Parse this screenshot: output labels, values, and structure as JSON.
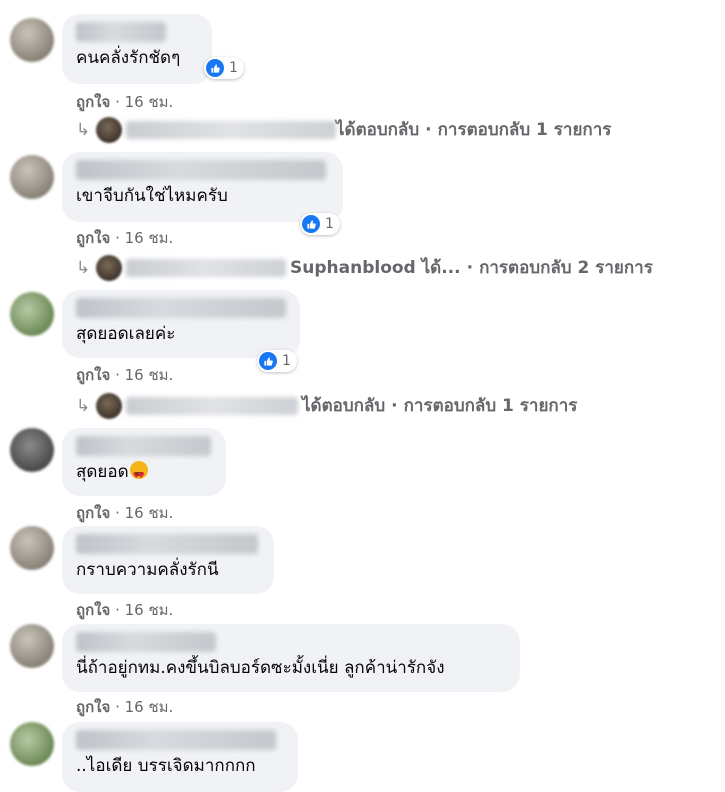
{
  "comments": [
    {
      "text": "คนคลั่งรักชัดๆ",
      "reactions": "1",
      "like": "ถูกใจ",
      "time": "16 ชม.",
      "reply": {
        "suffix": "ได้ตอบกลับ",
        "count": "การตอบกลับ 1 รายการ"
      }
    },
    {
      "text": "เขาจีบกันใช่ไหมครับ",
      "reactions": "1",
      "like": "ถูกใจ",
      "time": "16 ชม.",
      "reply": {
        "suffix": "Suphanblood ได้...",
        "count": "การตอบกลับ 2 รายการ"
      }
    },
    {
      "text": "สุดยอดเลยค่ะ",
      "reactions": "1",
      "like": "ถูกใจ",
      "time": "16 ชม.",
      "reply": {
        "suffix": "ได้ตอบกลับ",
        "count": "การตอบกลับ 1 รายการ"
      }
    },
    {
      "text": "สุดยอด",
      "emoji": "heart-eyes-emoji",
      "like": "ถูกใจ",
      "time": "16 ชม."
    },
    {
      "text": "กราบความคลั่งรักนี",
      "like": "ถูกใจ",
      "time": "16 ชม."
    },
    {
      "text": "นี่ถ้าอยู่กทม.คงขึ้นบิลบอร์ดซะมั้งเนี่ย ลูกค้าน่ารักจัง",
      "like": "ถูกใจ",
      "time": "16 ชม."
    },
    {
      "text": "..ไอเดีย บรรเจิดมากกกก"
    }
  ],
  "separator": "·",
  "icons": {
    "like": "thumbs-up-icon",
    "reply": "reply-arrow-icon"
  },
  "colors": {
    "bubble": "#f0f2f5",
    "like_blue": "#1877f2",
    "meta": "#65676b"
  }
}
